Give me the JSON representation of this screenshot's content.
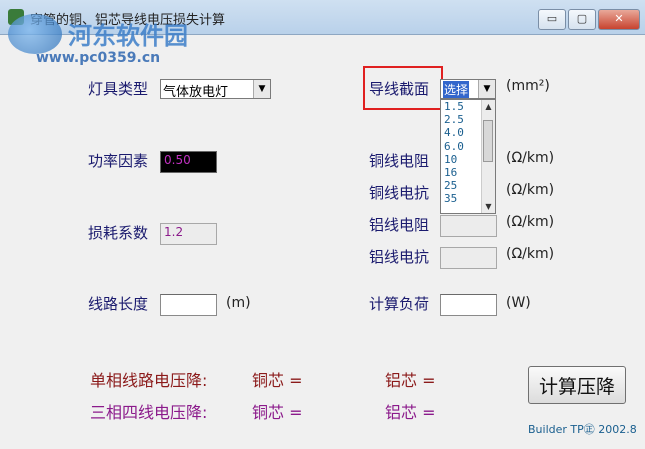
{
  "window": {
    "title": "穿管的铜、铝芯导线电压损失计算",
    "minimize_glyph": "▭",
    "maximize_glyph": "▢",
    "close_glyph": "✕"
  },
  "watermark": {
    "brand": "河东软件园",
    "url": "www.pc0359.cn"
  },
  "form": {
    "lamp_type": {
      "label": "灯具类型",
      "value": "气体放电灯"
    },
    "power_factor": {
      "label": "功率因素",
      "value": "0.50",
      "value_color": "#c030c0"
    },
    "loss_coefficient": {
      "label": "损耗系数",
      "value": "1.2"
    },
    "line_length": {
      "label": "线路长度",
      "value": "",
      "unit": "(m)"
    },
    "wire_section": {
      "label": "导线截面",
      "value": "选择",
      "unit": "(mm²)",
      "options": [
        "1.5",
        "2.5",
        "4.0",
        "6.0",
        "10",
        "16",
        "25",
        "35"
      ]
    },
    "copper_resistance": {
      "label": "铜线电阻",
      "value": "",
      "unit": "(Ω/km)"
    },
    "copper_reactance": {
      "label": "铜线电抗",
      "value": "",
      "unit": "(Ω/km)"
    },
    "aluminum_resistance": {
      "label": "铝线电阻",
      "value": "",
      "unit": "(Ω/km)"
    },
    "aluminum_reactance": {
      "label": "铝线电抗",
      "value": "",
      "unit": "(Ω/km)"
    },
    "calc_load": {
      "label": "计算负荷",
      "value": "",
      "unit": "(W)"
    }
  },
  "results": {
    "single_phase": {
      "label": "单相线路电压降:",
      "copper": "铜芯 =",
      "aluminum": "铝芯 ="
    },
    "three_phase": {
      "label": "三相四线电压降:",
      "copper": "铜芯 =",
      "aluminum": "铝芯 ="
    }
  },
  "actions": {
    "calculate_label": "计算压降"
  },
  "footer": {
    "text": "Builder TP㊣ 2002.8"
  },
  "colors": {
    "label": "#1a1a6e",
    "highlight": "#e02020",
    "result_single": "#8b1a1a",
    "result_three": "#8b1a8b"
  }
}
